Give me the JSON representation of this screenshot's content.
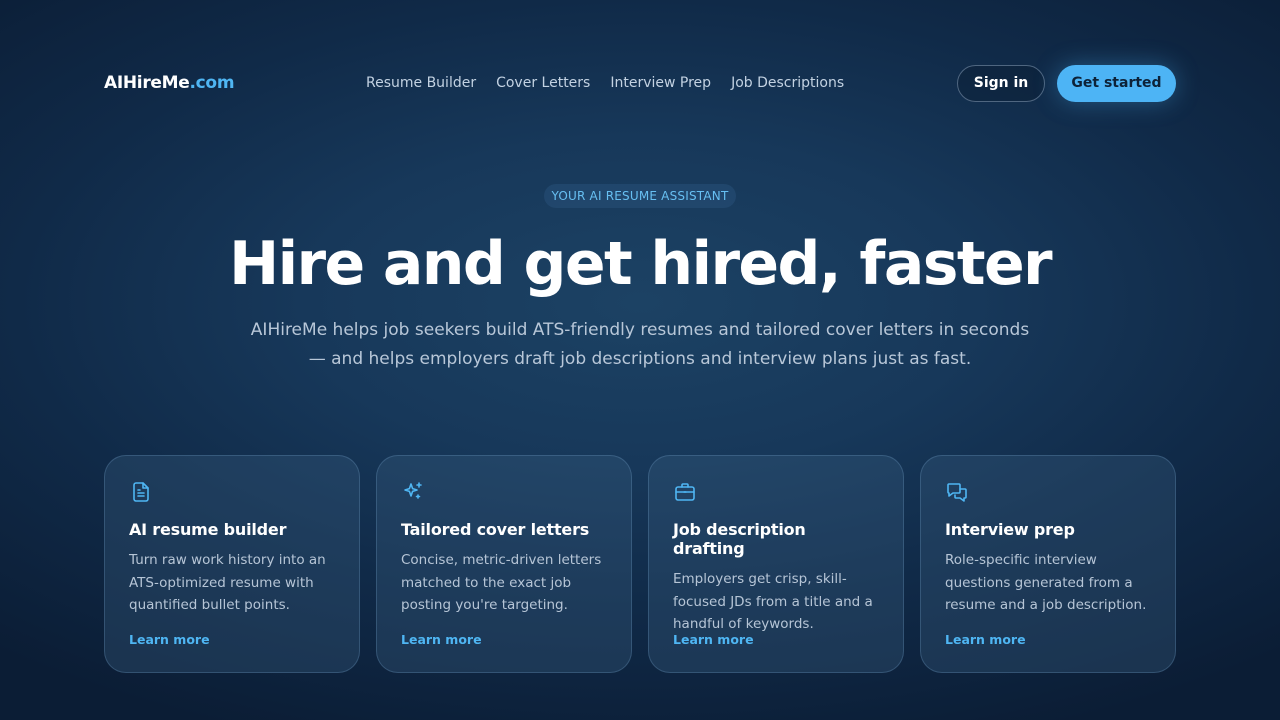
{
  "header": {
    "logo_main": "AIHireMe",
    "logo_tld": ".com",
    "nav": [
      {
        "label": "Resume Builder"
      },
      {
        "label": "Cover Letters"
      },
      {
        "label": "Interview Prep"
      },
      {
        "label": "Job Descriptions"
      }
    ],
    "signin_label": "Sign in",
    "start_label": "Get started"
  },
  "hero": {
    "eyebrow": "YOUR AI RESUME ASSISTANT",
    "title": "Hire and get hired, faster",
    "subtitle": "AIHireMe helps job seekers build ATS-friendly resumes and tailored cover letters in seconds — and helps employers draft job descriptions and interview plans just as fast."
  },
  "cards": [
    {
      "icon": "document-icon",
      "title": "AI resume builder",
      "body": "Turn raw work history into an ATS-optimized resume with quantified bullet points.",
      "link": "Learn more"
    },
    {
      "icon": "sparkles-icon",
      "title": "Tailored cover letters",
      "body": "Concise, metric-driven letters matched to the exact job posting you're targeting.",
      "link": "Learn more"
    },
    {
      "icon": "briefcase-icon",
      "title": "Job description drafting",
      "body": "Employers get crisp, skill-focused JDs from a title and a handful of keywords.",
      "link": "Learn more"
    },
    {
      "icon": "chat-bubbles-icon",
      "title": "Interview prep",
      "body": "Role-specific interview questions generated from a resume and a job description.",
      "link": "Learn more"
    }
  ],
  "colors": {
    "accent": "#4db4f5",
    "background": "#17385a",
    "text_muted": "#b8c7d8"
  }
}
